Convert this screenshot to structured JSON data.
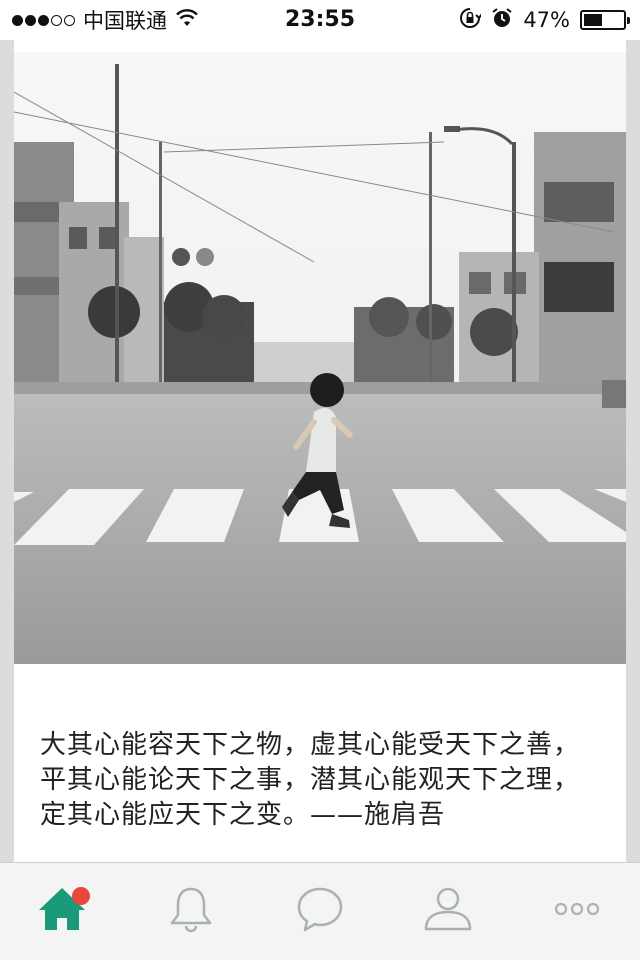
{
  "status_bar": {
    "carrier": "中国联通",
    "time": "23:55",
    "battery": "47%",
    "battery_level": 0.47,
    "signal_bars_filled": 3,
    "signal_bars_total": 5,
    "icons": [
      "wifi-icon",
      "rotation-lock-icon",
      "alarm-icon",
      "battery-icon"
    ]
  },
  "post": {
    "image": "black-and-white photo of a child running across a crosswalk on a city street",
    "quote": "大其心能容天下之物，虚其心能受天下之善，平其心能论天下之事，潜其心能观天下之理，定其心能应天下之变。——施肩吾"
  },
  "tab_bar": {
    "tabs": [
      {
        "name": "home",
        "icon": "home-icon",
        "active": true,
        "has_badge": true
      },
      {
        "name": "notifications",
        "icon": "bell-icon",
        "active": false
      },
      {
        "name": "messages",
        "icon": "chat-bubble-icon",
        "active": false
      },
      {
        "name": "profile",
        "icon": "person-icon",
        "active": false
      },
      {
        "name": "more",
        "icon": "more-dots-icon",
        "active": false
      }
    ]
  },
  "colors": {
    "accent": "#1a9a78",
    "badge": "#e8473b",
    "inactive_icon": "#a8b3b0"
  }
}
